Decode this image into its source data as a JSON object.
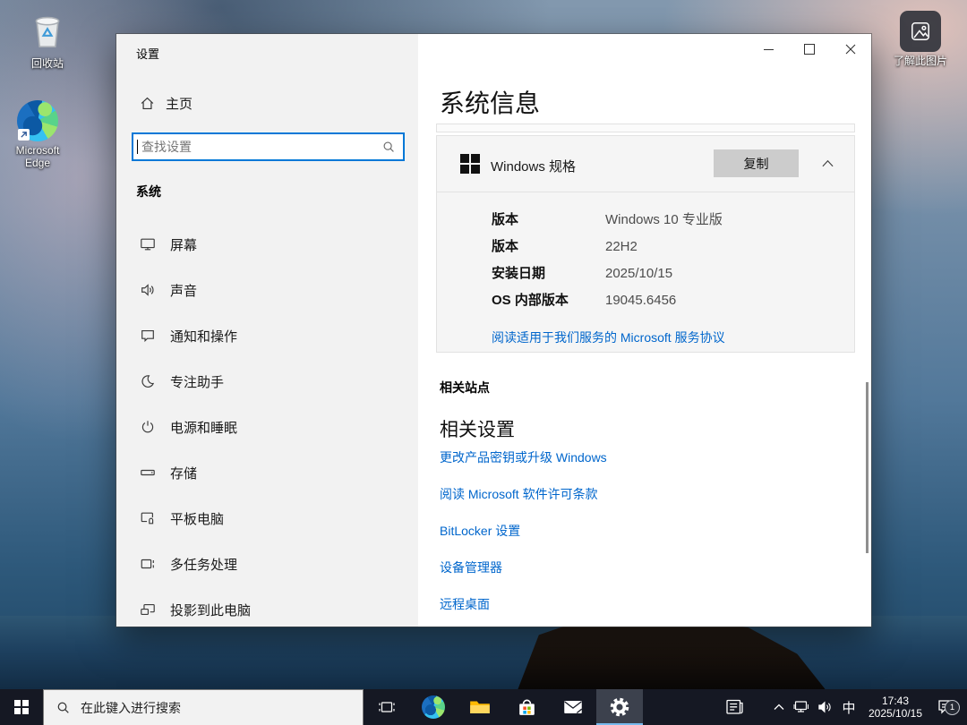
{
  "colors": {
    "accent": "#0078d7",
    "link": "#0066cc",
    "taskbar": "#151823",
    "active_underline": "#76b9ed",
    "copy_button_bg": "#cccccc"
  },
  "desktop": {
    "icons": [
      {
        "label": "回收站"
      },
      {
        "label": "Microsoft Edge"
      },
      {
        "label": "了解此图片"
      }
    ]
  },
  "window": {
    "title": "设置",
    "sidebar": {
      "home": "主页",
      "search_placeholder": "查找设置",
      "section": "系统",
      "items": [
        {
          "label": "屏幕"
        },
        {
          "label": "声音"
        },
        {
          "label": "通知和操作"
        },
        {
          "label": "专注助手"
        },
        {
          "label": "电源和睡眠"
        },
        {
          "label": "存储"
        },
        {
          "label": "平板电脑"
        },
        {
          "label": "多任务处理"
        },
        {
          "label": "投影到此电脑"
        }
      ]
    },
    "main": {
      "page_title": "系统信息",
      "spec_card": {
        "title": "Windows 规格",
        "copy": "复制",
        "rows": [
          {
            "label": "版本",
            "value": "Windows 10 专业版"
          },
          {
            "label": "版本",
            "value": "22H2"
          },
          {
            "label": "安装日期",
            "value": "2025/10/15"
          },
          {
            "label": "OS 内部版本",
            "value": "19045.6456"
          }
        ],
        "link": "阅读适用于我们服务的 Microsoft 服务协议"
      },
      "related_sites": "相关站点",
      "related_settings": "相关设置",
      "links": [
        {
          "label": "更改产品密钥或升级 Windows"
        },
        {
          "label": "阅读 Microsoft 软件许可条款"
        },
        {
          "label": "BitLocker 设置"
        },
        {
          "label": "设备管理器"
        },
        {
          "label": "远程桌面"
        }
      ]
    }
  },
  "taskbar": {
    "search_placeholder": "在此键入进行搜索",
    "ime": "中",
    "time": "17:43",
    "date": "2025/10/15",
    "notification_count": "1"
  }
}
